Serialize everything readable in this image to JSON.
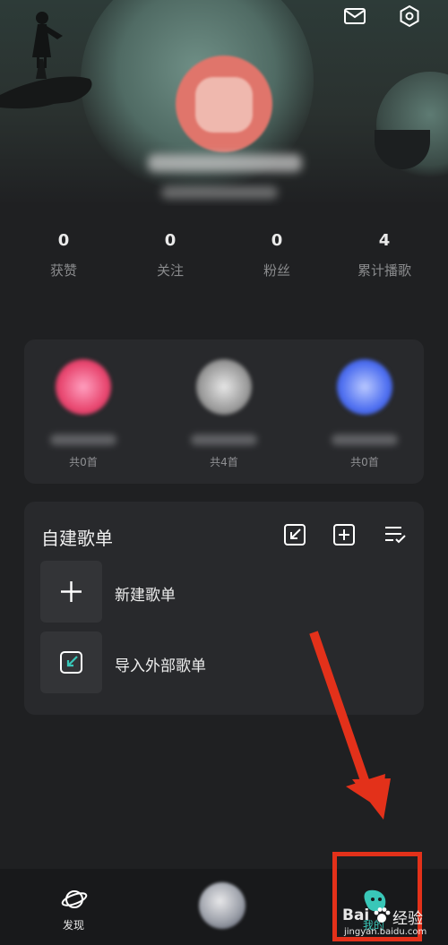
{
  "stats": [
    {
      "value": "0",
      "label": "获赞"
    },
    {
      "value": "0",
      "label": "关注"
    },
    {
      "value": "0",
      "label": "粉丝"
    },
    {
      "value": "4",
      "label": "累计播歌"
    }
  ],
  "collections": [
    {
      "count": "共0首",
      "color": "#e8466f"
    },
    {
      "count": "共4首",
      "color": "#9a9a9a"
    },
    {
      "count": "共0首",
      "color": "#4d6ef0"
    }
  ],
  "playlists": {
    "section_title": "自建歌单",
    "items": [
      {
        "label": "新建歌单",
        "icon": "plus-icon"
      },
      {
        "label": "导入外部歌单",
        "icon": "import-icon"
      }
    ]
  },
  "bottom_nav": {
    "discover_label": "发现",
    "mine_label": "我的"
  },
  "watermark": {
    "brand": "Bai",
    "brand2": "经验",
    "url": "jingyan.baidu.com"
  },
  "colors": {
    "accent_teal": "#39c7b8",
    "highlight_red": "#e3311a"
  }
}
